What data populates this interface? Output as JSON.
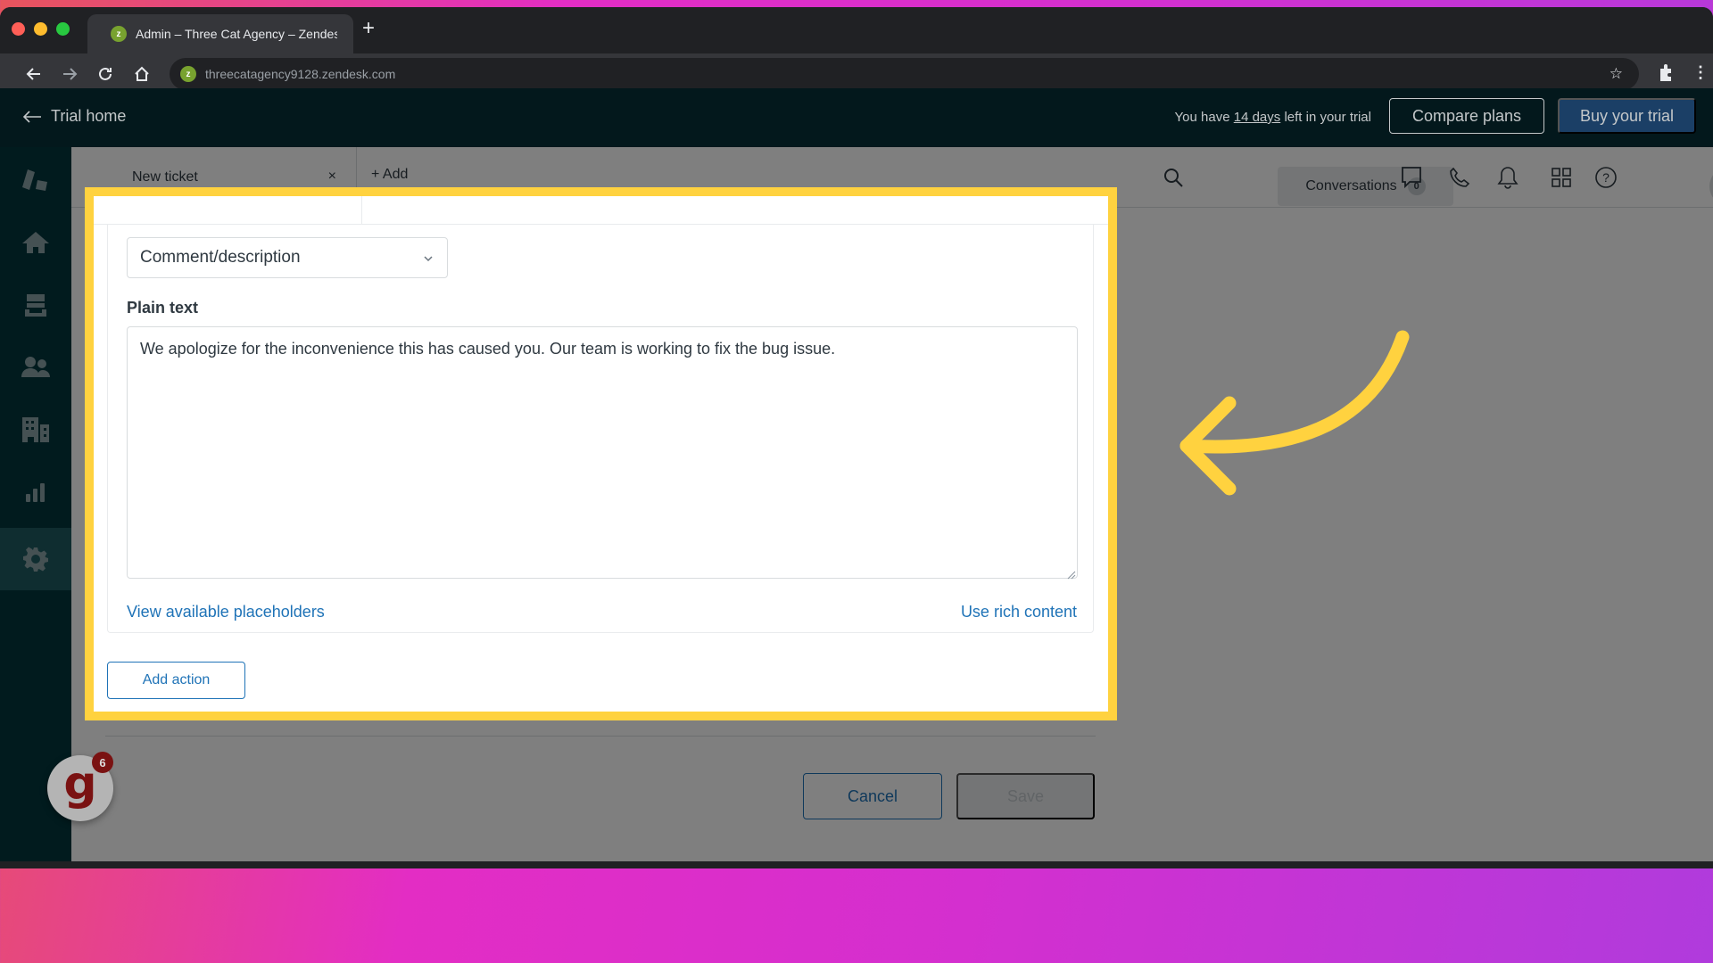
{
  "browser": {
    "tab_title": "Admin – Three Cat Agency – Zendesk",
    "favicon_letter": "z",
    "new_tab_symbol": "+",
    "url": "threecatagency9128.zendesk.com"
  },
  "trial_bar": {
    "back_label": "Trial home",
    "message_prefix": "You have ",
    "days_link": "14 days",
    "message_suffix": " left in your trial",
    "compare_plans": "Compare plans",
    "buy_trial": "Buy your trial"
  },
  "sidebar": {
    "items": [
      {
        "name": "zendesk-logo"
      },
      {
        "name": "home"
      },
      {
        "name": "views"
      },
      {
        "name": "customers"
      },
      {
        "name": "organizations"
      },
      {
        "name": "reporting"
      },
      {
        "name": "admin",
        "active": true
      }
    ]
  },
  "header": {
    "ticket_tab": "New ticket",
    "close_symbol": "×",
    "add_label": "+ Add",
    "conversations_label": "Conversations",
    "conversations_count": "0"
  },
  "action_editor": {
    "field_select": "Comment/description",
    "label": "Plain text",
    "text": "We apologize for the inconvenience this has caused you. Our team is working to fix the bug issue.",
    "placeholders_link": "View available placeholders",
    "rich_content_link": "Use rich content",
    "add_action": "Add action"
  },
  "footer": {
    "cancel": "Cancel",
    "save": "Save"
  },
  "widget": {
    "letter": "g",
    "badge": "6"
  },
  "colors": {
    "highlight": "#ffd23f",
    "link_blue": "#1f73b7",
    "sidebar": "#03363d",
    "trial_bar": "#03181c",
    "buy_button": "#1b3f66"
  }
}
